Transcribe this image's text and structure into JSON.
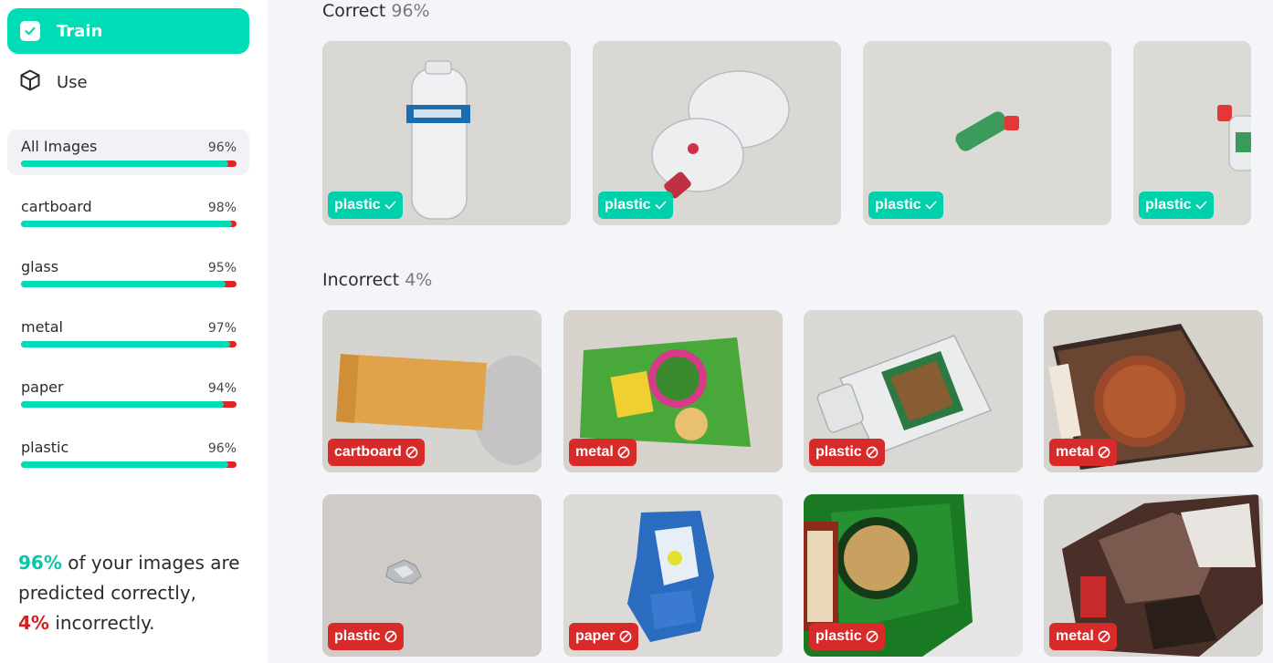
{
  "nav": {
    "train_label": "Train",
    "use_label": "Use"
  },
  "categories": [
    {
      "name": "All Images",
      "percent_label": "96%",
      "accuracy": 0.96
    },
    {
      "name": "cartboard",
      "percent_label": "98%",
      "accuracy": 0.98
    },
    {
      "name": "glass",
      "percent_label": "95%",
      "accuracy": 0.95
    },
    {
      "name": "metal",
      "percent_label": "97%",
      "accuracy": 0.97
    },
    {
      "name": "paper",
      "percent_label": "94%",
      "accuracy": 0.94
    },
    {
      "name": "plastic",
      "percent_label": "96%",
      "accuracy": 0.96
    }
  ],
  "summary": {
    "correct_pct": "96%",
    "line1": " of your images are",
    "line2": "predicted correctly,",
    "incorrect_pct": "4%",
    "line3": " incorrectly."
  },
  "correct_section": {
    "title": "Correct",
    "percent": "96%",
    "items": [
      {
        "label": "plastic"
      },
      {
        "label": "plastic"
      },
      {
        "label": "plastic"
      },
      {
        "label": "plastic"
      }
    ]
  },
  "incorrect_section": {
    "title": "Incorrect",
    "percent": "4%",
    "items": [
      {
        "label": "cartboard"
      },
      {
        "label": "metal"
      },
      {
        "label": "plastic"
      },
      {
        "label": "metal"
      },
      {
        "label": "plastic"
      },
      {
        "label": "paper"
      },
      {
        "label": "plastic"
      },
      {
        "label": "metal"
      }
    ]
  },
  "colors": {
    "accent": "#00dcb5",
    "error": "#d92a2a",
    "background": "#f4f5f8"
  }
}
